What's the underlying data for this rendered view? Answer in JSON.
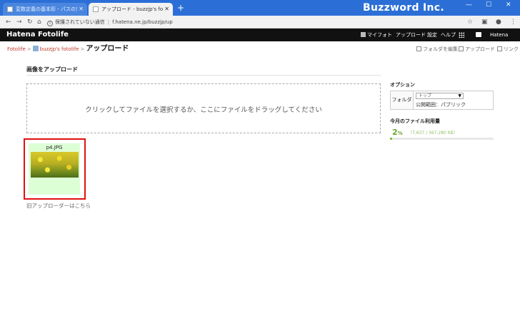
{
  "browser": {
    "tabs": [
      {
        "title": "変数定義の基本形 - パスの宣言で使う",
        "active": false
      },
      {
        "title": "アップロード - buzzjp's fotolife",
        "active": true
      }
    ],
    "new_tab": "+",
    "brand": "Buzzword Inc.",
    "security_text": "保護されていない通信",
    "url": "f.hatena.ne.jp/buzzjp/up"
  },
  "site_header": {
    "logo": "Hatena Fotolife",
    "nav": [
      "マイフォト",
      "アップロード",
      "設定",
      "ヘルプ"
    ],
    "hatena": "Hatena"
  },
  "breadcrumb": {
    "root": "Fotolife",
    "user": "buzzjp's fotolife",
    "current": "アップロード"
  },
  "page_actions": [
    "フォルダを編集",
    "アップロード",
    "リンク"
  ],
  "main": {
    "section_title": "画像をアップロード",
    "dropzone_text": "クリックしてファイルを選択するか、ここにファイルをドラッグしてください",
    "uploaded": [
      {
        "filename": "p4.JPG"
      }
    ],
    "old_uploader_link": "旧アップローダーはこちら"
  },
  "sidebar": {
    "options_title": "オプション",
    "folder_label": "フォルダ",
    "folder_selected": "トップ",
    "visibility": "公開範囲：パブリック",
    "usage_title": "今月のファイル利用量",
    "usage_percent": "2",
    "usage_percent_unit": "%",
    "usage_detail": "（7,637 / 367,280 KB）",
    "usage_fraction": 0.02
  }
}
